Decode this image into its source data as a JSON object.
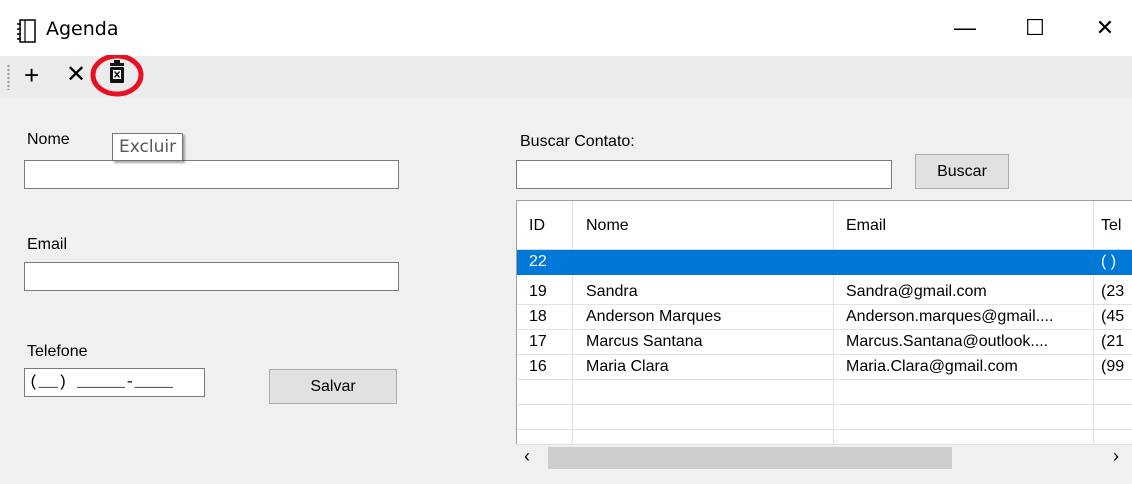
{
  "window": {
    "title": "Agenda",
    "minimize": "—",
    "maximize": "☐",
    "close": "✕"
  },
  "toolbar": {
    "add_icon": "+",
    "cancel_icon": "✕",
    "delete_icon": "trash-icon",
    "highlight_color": "#e81123"
  },
  "tooltip": "Excluir",
  "form": {
    "nome_label": "Nome",
    "nome_value": "",
    "email_label": "Email",
    "email_value": "",
    "telefone_label": "Telefone",
    "telefone_mask": "(__) _____-____",
    "salvar_label": "Salvar"
  },
  "search": {
    "label": "Buscar Contato:",
    "value": "",
    "button_label": "Buscar"
  },
  "grid": {
    "columns": [
      "ID",
      "Nome",
      "Email",
      "Tel"
    ],
    "rows": [
      {
        "id": "22",
        "nome": "",
        "email": "",
        "tel": "( )"
      },
      {
        "id": "19",
        "nome": "Sandra",
        "email": "Sandra@gmail.com",
        "tel": "(23"
      },
      {
        "id": "18",
        "nome": "Anderson Marques",
        "email": "Anderson.marques@gmail....",
        "tel": "(45"
      },
      {
        "id": "17",
        "nome": "Marcus Santana",
        "email": "Marcus.Santana@outlook....",
        "tel": "(21"
      },
      {
        "id": "16",
        "nome": "Maria Clara",
        "email": "Maria.Clara@gmail.com",
        "tel": "(99"
      }
    ],
    "selected_color": "#0078d7",
    "scroll_left": "‹",
    "scroll_right": "›"
  }
}
